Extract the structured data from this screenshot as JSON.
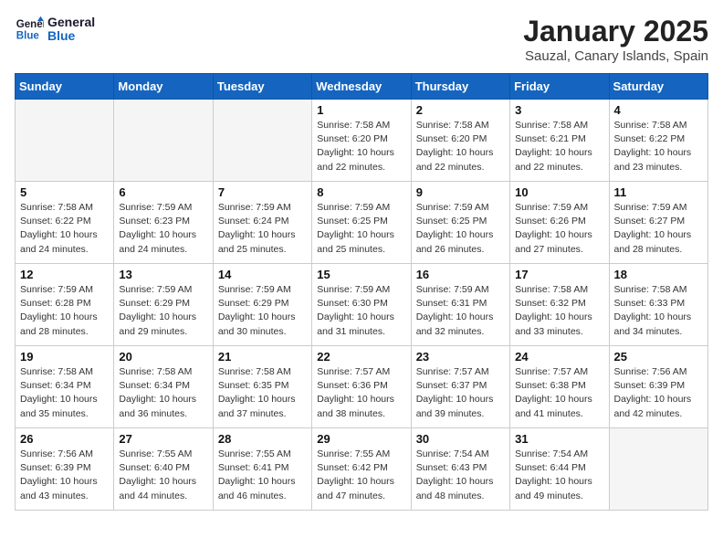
{
  "logo": {
    "line1": "General",
    "line2": "Blue"
  },
  "title": "January 2025",
  "subtitle": "Sauzal, Canary Islands, Spain",
  "weekdays": [
    "Sunday",
    "Monday",
    "Tuesday",
    "Wednesday",
    "Thursday",
    "Friday",
    "Saturday"
  ],
  "weeks": [
    [
      {
        "day": "",
        "detail": ""
      },
      {
        "day": "",
        "detail": ""
      },
      {
        "day": "",
        "detail": ""
      },
      {
        "day": "1",
        "detail": "Sunrise: 7:58 AM\nSunset: 6:20 PM\nDaylight: 10 hours\nand 22 minutes."
      },
      {
        "day": "2",
        "detail": "Sunrise: 7:58 AM\nSunset: 6:20 PM\nDaylight: 10 hours\nand 22 minutes."
      },
      {
        "day": "3",
        "detail": "Sunrise: 7:58 AM\nSunset: 6:21 PM\nDaylight: 10 hours\nand 22 minutes."
      },
      {
        "day": "4",
        "detail": "Sunrise: 7:58 AM\nSunset: 6:22 PM\nDaylight: 10 hours\nand 23 minutes."
      }
    ],
    [
      {
        "day": "5",
        "detail": "Sunrise: 7:58 AM\nSunset: 6:22 PM\nDaylight: 10 hours\nand 24 minutes."
      },
      {
        "day": "6",
        "detail": "Sunrise: 7:59 AM\nSunset: 6:23 PM\nDaylight: 10 hours\nand 24 minutes."
      },
      {
        "day": "7",
        "detail": "Sunrise: 7:59 AM\nSunset: 6:24 PM\nDaylight: 10 hours\nand 25 minutes."
      },
      {
        "day": "8",
        "detail": "Sunrise: 7:59 AM\nSunset: 6:25 PM\nDaylight: 10 hours\nand 25 minutes."
      },
      {
        "day": "9",
        "detail": "Sunrise: 7:59 AM\nSunset: 6:25 PM\nDaylight: 10 hours\nand 26 minutes."
      },
      {
        "day": "10",
        "detail": "Sunrise: 7:59 AM\nSunset: 6:26 PM\nDaylight: 10 hours\nand 27 minutes."
      },
      {
        "day": "11",
        "detail": "Sunrise: 7:59 AM\nSunset: 6:27 PM\nDaylight: 10 hours\nand 28 minutes."
      }
    ],
    [
      {
        "day": "12",
        "detail": "Sunrise: 7:59 AM\nSunset: 6:28 PM\nDaylight: 10 hours\nand 28 minutes."
      },
      {
        "day": "13",
        "detail": "Sunrise: 7:59 AM\nSunset: 6:29 PM\nDaylight: 10 hours\nand 29 minutes."
      },
      {
        "day": "14",
        "detail": "Sunrise: 7:59 AM\nSunset: 6:29 PM\nDaylight: 10 hours\nand 30 minutes."
      },
      {
        "day": "15",
        "detail": "Sunrise: 7:59 AM\nSunset: 6:30 PM\nDaylight: 10 hours\nand 31 minutes."
      },
      {
        "day": "16",
        "detail": "Sunrise: 7:59 AM\nSunset: 6:31 PM\nDaylight: 10 hours\nand 32 minutes."
      },
      {
        "day": "17",
        "detail": "Sunrise: 7:58 AM\nSunset: 6:32 PM\nDaylight: 10 hours\nand 33 minutes."
      },
      {
        "day": "18",
        "detail": "Sunrise: 7:58 AM\nSunset: 6:33 PM\nDaylight: 10 hours\nand 34 minutes."
      }
    ],
    [
      {
        "day": "19",
        "detail": "Sunrise: 7:58 AM\nSunset: 6:34 PM\nDaylight: 10 hours\nand 35 minutes."
      },
      {
        "day": "20",
        "detail": "Sunrise: 7:58 AM\nSunset: 6:34 PM\nDaylight: 10 hours\nand 36 minutes."
      },
      {
        "day": "21",
        "detail": "Sunrise: 7:58 AM\nSunset: 6:35 PM\nDaylight: 10 hours\nand 37 minutes."
      },
      {
        "day": "22",
        "detail": "Sunrise: 7:57 AM\nSunset: 6:36 PM\nDaylight: 10 hours\nand 38 minutes."
      },
      {
        "day": "23",
        "detail": "Sunrise: 7:57 AM\nSunset: 6:37 PM\nDaylight: 10 hours\nand 39 minutes."
      },
      {
        "day": "24",
        "detail": "Sunrise: 7:57 AM\nSunset: 6:38 PM\nDaylight: 10 hours\nand 41 minutes."
      },
      {
        "day": "25",
        "detail": "Sunrise: 7:56 AM\nSunset: 6:39 PM\nDaylight: 10 hours\nand 42 minutes."
      }
    ],
    [
      {
        "day": "26",
        "detail": "Sunrise: 7:56 AM\nSunset: 6:39 PM\nDaylight: 10 hours\nand 43 minutes."
      },
      {
        "day": "27",
        "detail": "Sunrise: 7:55 AM\nSunset: 6:40 PM\nDaylight: 10 hours\nand 44 minutes."
      },
      {
        "day": "28",
        "detail": "Sunrise: 7:55 AM\nSunset: 6:41 PM\nDaylight: 10 hours\nand 46 minutes."
      },
      {
        "day": "29",
        "detail": "Sunrise: 7:55 AM\nSunset: 6:42 PM\nDaylight: 10 hours\nand 47 minutes."
      },
      {
        "day": "30",
        "detail": "Sunrise: 7:54 AM\nSunset: 6:43 PM\nDaylight: 10 hours\nand 48 minutes."
      },
      {
        "day": "31",
        "detail": "Sunrise: 7:54 AM\nSunset: 6:44 PM\nDaylight: 10 hours\nand 49 minutes."
      },
      {
        "day": "",
        "detail": ""
      }
    ]
  ]
}
